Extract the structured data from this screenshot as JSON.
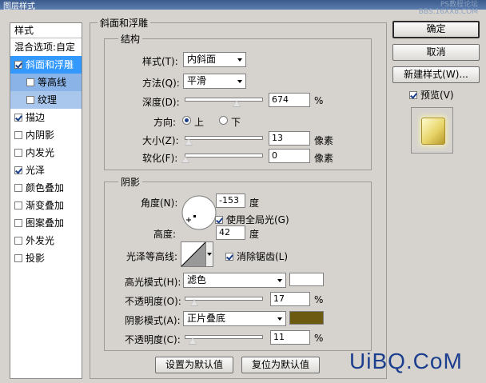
{
  "window": {
    "title": "图层样式"
  },
  "watermark": {
    "line1": "PS教程论坛",
    "line2": "BBS.16XX8.COM",
    "bottom": "UiBQ.CoM"
  },
  "left_panel": {
    "header": "样式",
    "blend_options": "混合选项:自定",
    "items": [
      {
        "label": "斜面和浮雕",
        "checked": true,
        "selected": true
      },
      {
        "label": "等高线",
        "checked": false,
        "sub": true
      },
      {
        "label": "纹理",
        "checked": false,
        "sub": true
      },
      {
        "label": "描边",
        "checked": true
      },
      {
        "label": "内阴影",
        "checked": false
      },
      {
        "label": "内发光",
        "checked": false
      },
      {
        "label": "光泽",
        "checked": true
      },
      {
        "label": "颜色叠加",
        "checked": false
      },
      {
        "label": "渐变叠加",
        "checked": false
      },
      {
        "label": "图案叠加",
        "checked": false
      },
      {
        "label": "外发光",
        "checked": false
      },
      {
        "label": "投影",
        "checked": false
      }
    ]
  },
  "bevel": {
    "title": "斜面和浮雕",
    "structure": {
      "title": "结构",
      "style_label": "样式(T):",
      "style_value": "内斜面",
      "technique_label": "方法(Q):",
      "technique_value": "平滑",
      "depth_label": "深度(D):",
      "depth_value": "674",
      "depth_unit": "%",
      "depth_level": 0.67,
      "direction_label": "方向:",
      "dir_up": "上",
      "dir_down": "下",
      "size_label": "大小(Z):",
      "size_value": "13",
      "size_unit": "像素",
      "size_level": 0.05,
      "soften_label": "软化(F):",
      "soften_value": "0",
      "soften_unit": "像素",
      "soften_level": 0.0
    },
    "shading": {
      "title": "阴影",
      "angle_label": "角度(N):",
      "angle_value": "-153",
      "angle_unit": "度",
      "global_light": "使用全局光(G)",
      "altitude_label": "高度:",
      "altitude_value": "42",
      "altitude_unit": "度",
      "gloss_label": "光泽等高线:",
      "antialias": "消除锯齿(L)",
      "highlight_label": "高光模式(H):",
      "highlight_value": "滤色",
      "highlight_color": "#ffffff",
      "hl_opacity_label": "不透明度(O):",
      "hl_opacity_value": "17",
      "hl_opacity_unit": "%",
      "hl_opacity_level": 0.17,
      "shadow_label": "阴影模式(A):",
      "shadow_value": "正片叠底",
      "shadow_color": "#6b5a10",
      "sh_opacity_label": "不透明度(C):",
      "sh_opacity_value": "11",
      "sh_opacity_unit": "%",
      "sh_opacity_level": 0.11
    },
    "make_default": "设置为默认值",
    "reset_default": "复位为默认值"
  },
  "right": {
    "ok": "确定",
    "cancel": "取消",
    "new_style": "新建样式(W)...",
    "preview": "预览(V)"
  }
}
